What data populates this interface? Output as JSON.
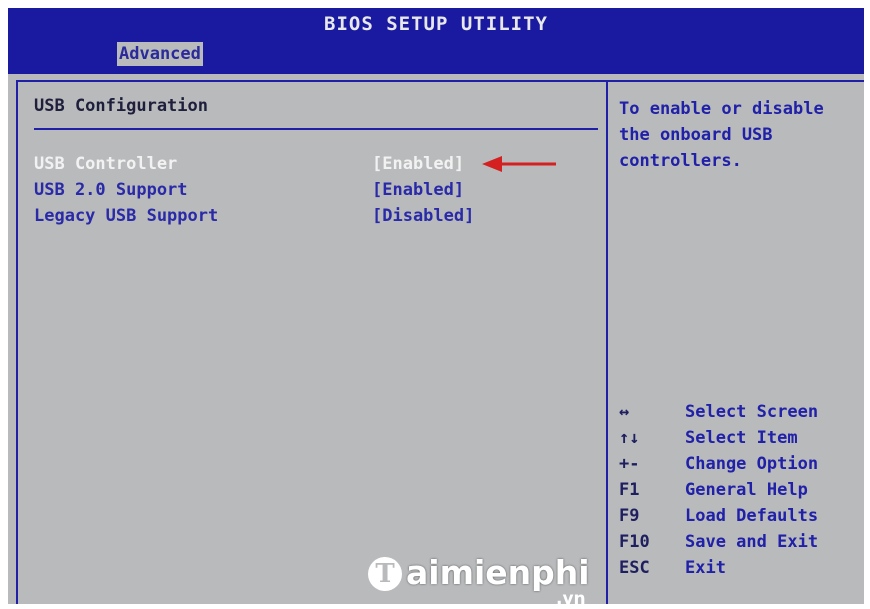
{
  "app": {
    "title": "BIOS SETUP UTILITY"
  },
  "tabs": [
    {
      "label": "Advanced"
    }
  ],
  "section": {
    "title": "USB Configuration"
  },
  "settings": [
    {
      "label": "USB Controller",
      "value": "[Enabled]",
      "selected": true
    },
    {
      "label": "USB 2.0 Support",
      "value": "[Enabled]",
      "selected": false
    },
    {
      "label": "Legacy USB Support",
      "value": "[Disabled]",
      "selected": false
    }
  ],
  "help": {
    "text": "To enable or disable the onboard USB controllers."
  },
  "keys": [
    {
      "key": "↔",
      "desc": "Select Screen"
    },
    {
      "key": "↑↓",
      "desc": "Select Item"
    },
    {
      "key": "+-",
      "desc": "Change Option"
    },
    {
      "key": "F1",
      "desc": "General Help"
    },
    {
      "key": "F9",
      "desc": "Load Defaults"
    },
    {
      "key": "F10",
      "desc": "Save and Exit"
    },
    {
      "key": "ESC",
      "desc": "Exit"
    }
  ],
  "watermark": {
    "initial": "T",
    "name": "aimienphi",
    "suffix": ".vn"
  },
  "colors": {
    "title_bar": "#1a1aa0",
    "panel_background": "#b8babc",
    "border": "#1f1fa8",
    "option_text": "#2a2aa8",
    "selected_text": "#f2f2f2",
    "annotation_arrow": "#d42020"
  },
  "icons": {
    "annotation": "red-arrow-icon"
  }
}
